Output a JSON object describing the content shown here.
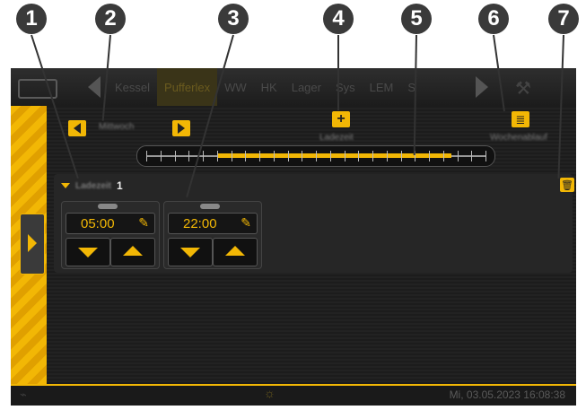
{
  "callouts": [
    "1",
    "2",
    "3",
    "4",
    "5",
    "6",
    "7"
  ],
  "tabs": [
    "",
    "Kessel",
    "Pufferlex",
    "WW",
    "HK",
    "Lager",
    "Sys",
    "LEM",
    "S"
  ],
  "active_tab": "Pufferlex",
  "day_label": "Mittwoch",
  "add_label": "Ladezeit",
  "reset_label": "Wochenablauf",
  "section_badge": "Ladezeit",
  "section_number": "1",
  "slider": {
    "start_fraction": 0.21,
    "end_fraction": 0.9,
    "tick_count": 25
  },
  "cards": [
    {
      "time": "05:00"
    },
    {
      "time": "22:00"
    }
  ],
  "status": {
    "datetime": "Mi, 03.05.2023 16:08:38"
  },
  "colors": {
    "accent": "#f2b705",
    "screen": "#1e1e1e"
  },
  "icons": {
    "prev": "arrow-left-icon",
    "next": "arrow-right-icon",
    "add": "plus-icon",
    "list": "list-icon",
    "delete": "trash-icon",
    "edit": "pencil-icon",
    "down": "triangle-down-icon",
    "up": "triangle-up-icon"
  }
}
